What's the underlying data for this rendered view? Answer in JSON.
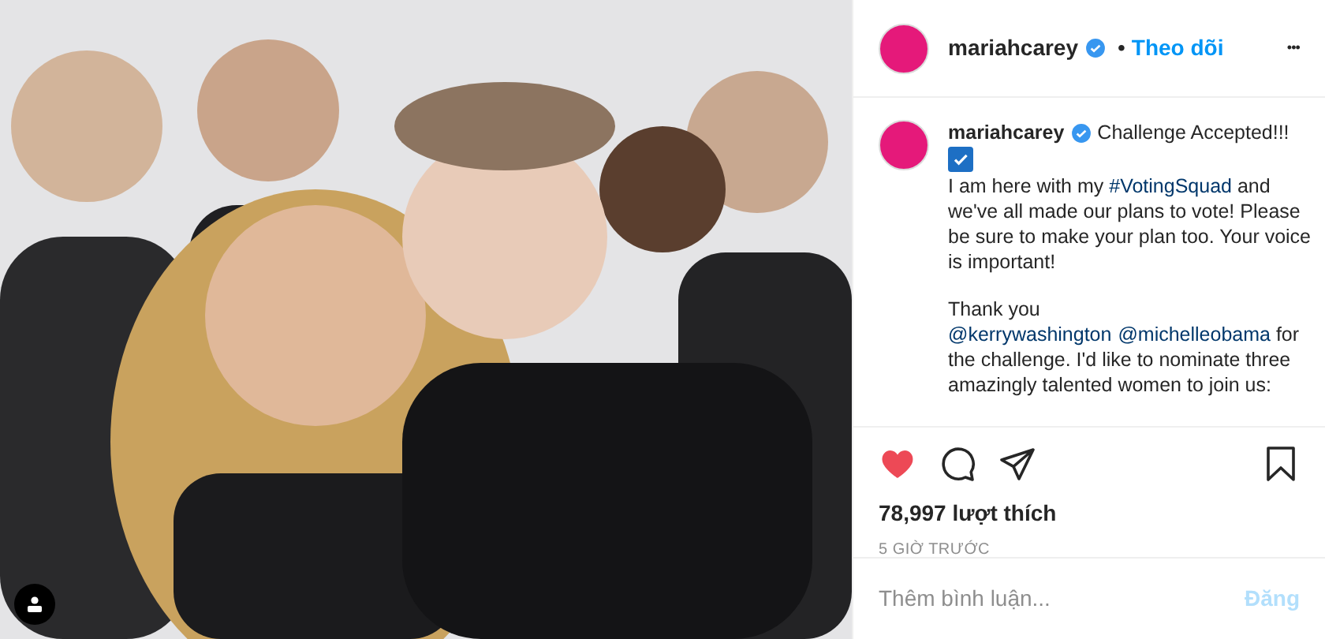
{
  "header": {
    "username": "mariahcarey",
    "verified": true,
    "separator": "•",
    "follow": "Theo dõi",
    "more": "•••"
  },
  "caption": {
    "username": "mariahcarey",
    "verified": true,
    "title": "Challenge Accepted!!!",
    "paragraphs": [
      [
        {
          "kind": "text",
          "text": "I am here with my "
        },
        {
          "kind": "link",
          "text": "#VotingSquad"
        },
        {
          "kind": "text",
          "text": " and we've all made our plans to vote! Please be sure to make your plan too. Your voice is important!"
        }
      ],
      [
        {
          "kind": "text",
          "text": "Thank you "
        },
        {
          "kind": "link",
          "text": "@kerrywashington"
        },
        {
          "kind": "link",
          "text": "@michelleobama"
        },
        {
          "kind": "text",
          "text": " for the challenge. I'd like to nominate three amazingly talented women to join us:"
        }
      ]
    ]
  },
  "actions": {
    "liked": true,
    "saved": false
  },
  "likes": "78,997 lượt thích",
  "time": "5 GIỜ TRƯỚC",
  "comment": {
    "placeholder": "Thêm bình luận...",
    "post_label": "Đăng",
    "disabled": true
  }
}
